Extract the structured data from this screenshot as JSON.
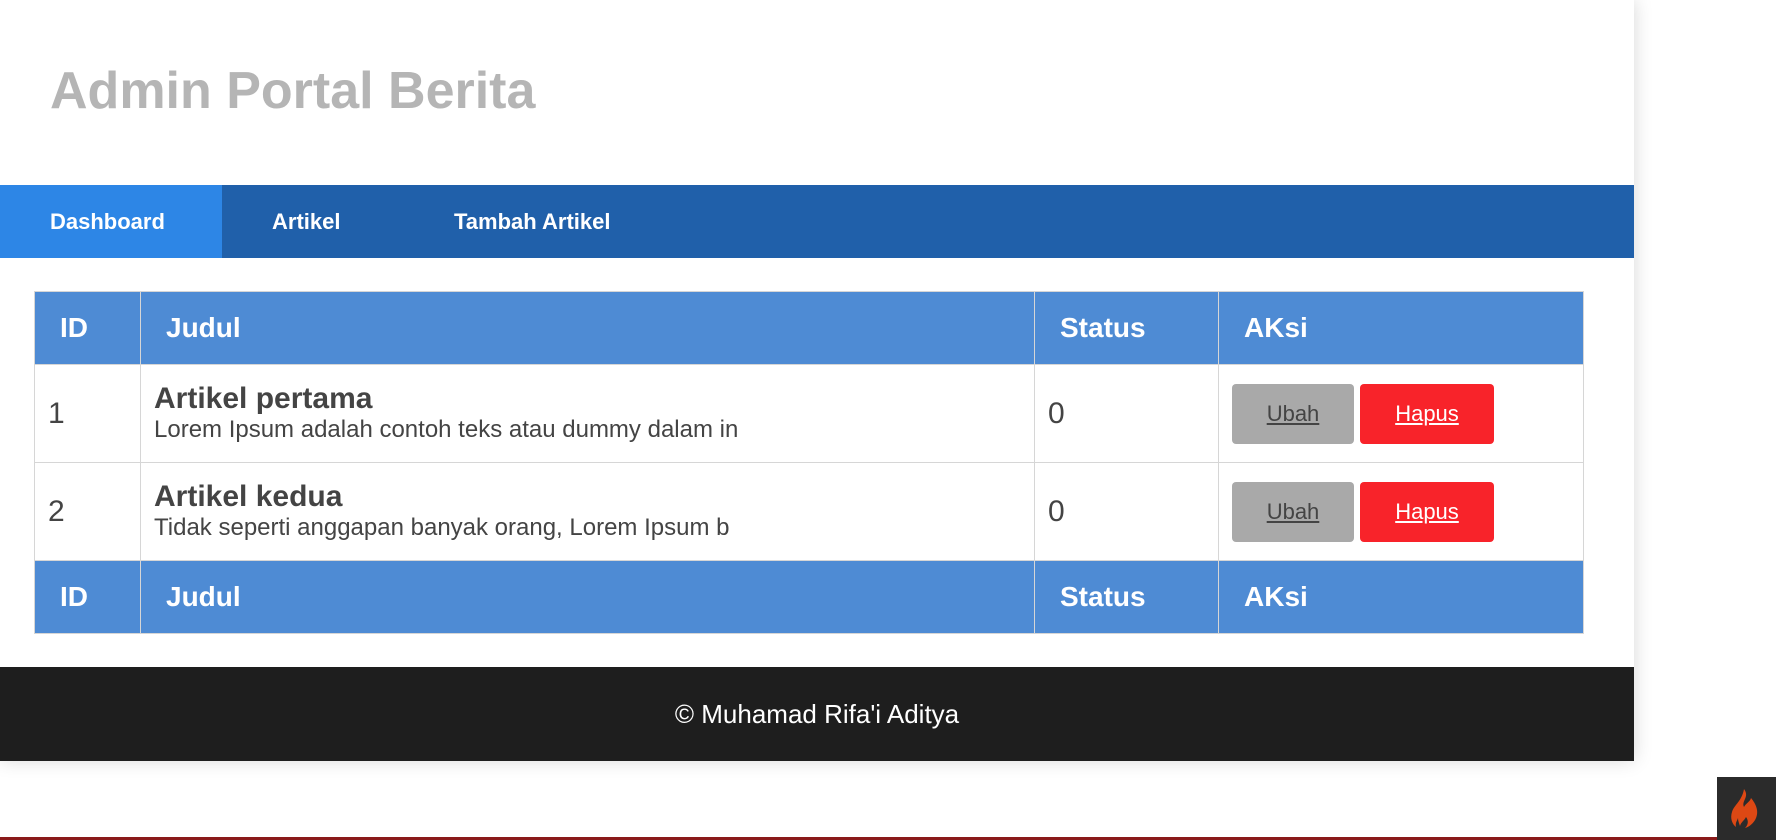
{
  "header": {
    "title": "Admin Portal Berita"
  },
  "nav": {
    "items": [
      {
        "label": "Dashboard"
      },
      {
        "label": "Artikel"
      },
      {
        "label": "Tambah Artikel"
      }
    ]
  },
  "table": {
    "columns": [
      "ID",
      "Judul",
      "Status",
      "AKsi"
    ],
    "rows": [
      {
        "id": "1",
        "title": "Artikel pertama",
        "excerpt": "Lorem Ipsum adalah contoh teks atau dummy dalam in",
        "status": "0",
        "edit_label": "Ubah",
        "delete_label": "Hapus"
      },
      {
        "id": "2",
        "title": "Artikel kedua",
        "excerpt": "Tidak seperti anggapan banyak orang, Lorem Ipsum b",
        "status": "0",
        "edit_label": "Ubah",
        "delete_label": "Hapus"
      }
    ]
  },
  "footer": {
    "text": "© Muhamad Rifa'i Aditya"
  },
  "debug_toolbar": {
    "icon": "codeigniter-flame-icon",
    "accent": "#dd4814"
  },
  "colors": {
    "nav_bg": "#2060aa",
    "nav_active": "#2d86e6",
    "table_header": "#4e8bd4",
    "delete_button": "#f8232a",
    "edit_button": "#a9a9a9",
    "footer_bg": "#1e1e1e"
  }
}
